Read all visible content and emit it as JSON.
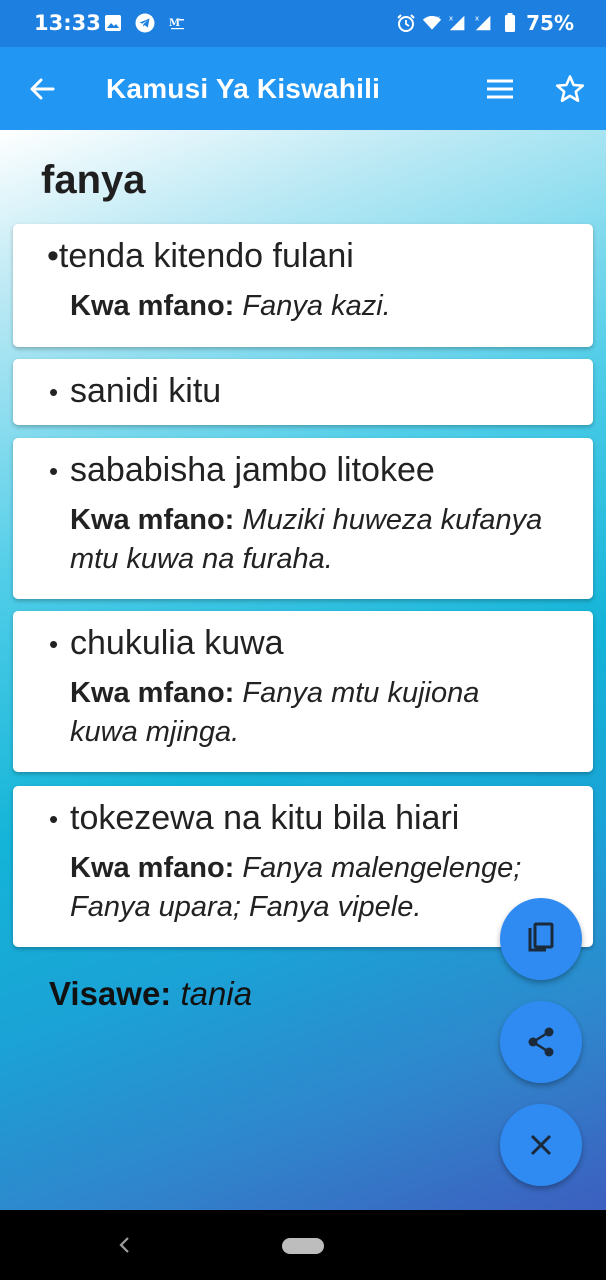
{
  "status_bar": {
    "time": "13:33",
    "battery": "75%",
    "left_icons": [
      "image-icon",
      "telegram-icon",
      "mail-icon"
    ],
    "right_icons": [
      "alarm-icon",
      "wifi-icon",
      "signal-icon",
      "signal-icon",
      "battery-icon"
    ]
  },
  "app_bar": {
    "title": "Kamusi Ya Kiswahili",
    "back_icon": "arrow-left-icon",
    "menu_icon": "hamburger-menu-icon",
    "favorite_icon": "star-outline-icon",
    "background": "#2196f3"
  },
  "entry": {
    "word": "fanya",
    "definitions": [
      {
        "bullet": "•",
        "text": "tenda kitendo fulani",
        "example_label": "Kwa mfano:",
        "example_line1": "Fanya kazi.",
        "example_line2": ""
      },
      {
        "bullet": "•",
        "text": " sanidi kitu",
        "example_label": "",
        "example_line1": "",
        "example_line2": ""
      },
      {
        "bullet": "•",
        "text": " sababisha jambo litokee",
        "example_label": "Kwa mfano:",
        "example_line1": "Muziki huweza kufanya",
        "example_line2": "mtu kuwa na furaha."
      },
      {
        "bullet": "•",
        "text": " chukulia kuwa",
        "example_label": "Kwa mfano:",
        "example_line1": "Fanya mtu kujiona",
        "example_line2": "kuwa mjinga."
      },
      {
        "bullet": "•",
        "text": " tokezewa na kitu bila hiari",
        "example_label": "Kwa mfano:",
        "example_line1": "Fanya malengelenge;",
        "example_line2": "Fanya upara; Fanya vipele."
      }
    ],
    "synonyms_label": "Visawe:",
    "synonyms_value": "tania"
  },
  "fabs": {
    "copy_icon": "copy-icon",
    "share_icon": "share-icon",
    "close_icon": "close-icon",
    "color": "#2f8bf2"
  },
  "nav_bar": {
    "back_icon": "chevron-left-icon",
    "home_icon": "home-pill-icon"
  }
}
